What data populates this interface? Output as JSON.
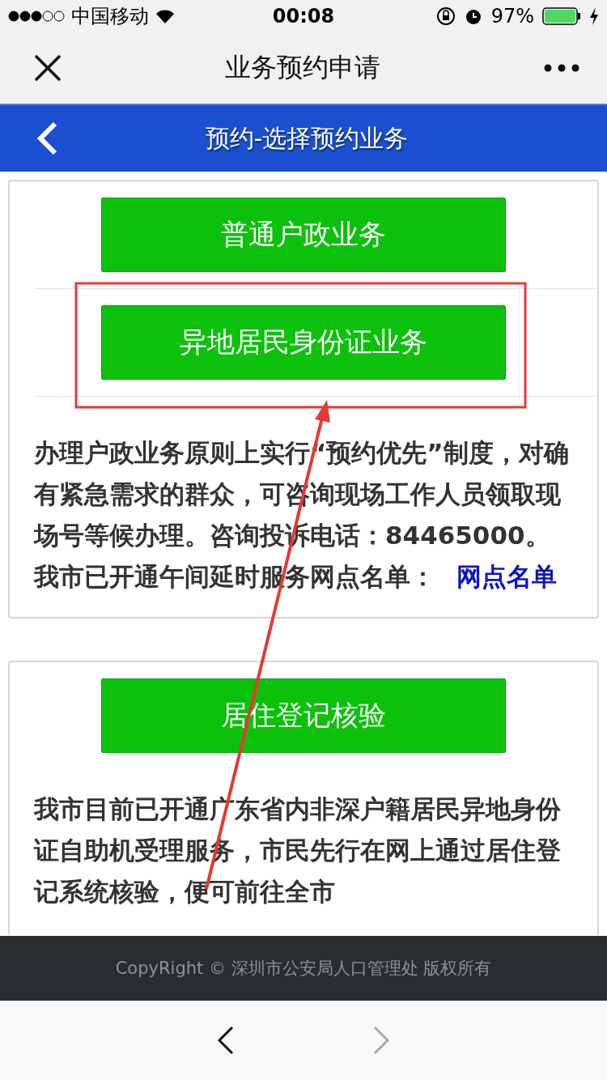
{
  "status_bar": {
    "carrier": "中国移动",
    "time": "00:08",
    "battery": "97%"
  },
  "nav_bar": {
    "title": "业务预约申请"
  },
  "header": {
    "title": "预约-选择预约业务"
  },
  "cards": [
    {
      "buttons": [
        "普通户政业务",
        "异地居民身份证业务"
      ],
      "text": "办理户政业务原则上实行“预约优先”制度，对确有紧急需求的群众，可咨询现场工作人员领取现场号等候办理。咨询投诉电话：84465000。我市已开通午间延时服务网点名单：",
      "link": "网点名单"
    },
    {
      "buttons": [
        "居住登记核验"
      ],
      "text": "我市目前已开通广东省内非深户籍居民异地身份证自助机受理服务，市民先行在网上通过居住登记系统核验，便可前往全市"
    }
  ],
  "footer": {
    "copyright": "CopyRight © 深圳市公安局人口管理处 版权所有"
  },
  "browser_nav": [
    {
      "kind": "back",
      "disabled": false
    },
    {
      "kind": "forward",
      "disabled": true
    }
  ]
}
